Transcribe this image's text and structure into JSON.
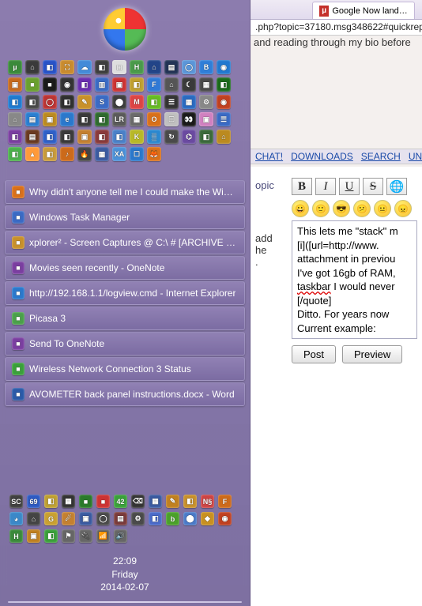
{
  "start": {
    "app_grid": [
      {
        "c": "#3a8a3a",
        "l": "µ"
      },
      {
        "c": "#3a3a3a",
        "l": "⌂"
      },
      {
        "c": "#2752c7",
        "l": "◧"
      },
      {
        "c": "#c98b2e",
        "l": "⛶"
      },
      {
        "c": "#438bd8",
        "l": "☁"
      },
      {
        "c": "#3d3d3d",
        "l": "◧"
      },
      {
        "c": "#dedede",
        "l": "◻"
      },
      {
        "c": "#4a9a4a",
        "l": "H"
      },
      {
        "c": "#224488",
        "l": "⌂"
      },
      {
        "c": "#223355",
        "l": "▤"
      },
      {
        "c": "#5a95d8",
        "l": "◯"
      },
      {
        "c": "#2f7ed8",
        "l": "B"
      },
      {
        "c": "#2178cf",
        "l": "◉"
      },
      {
        "c": "#c66a1e",
        "l": "▣"
      },
      {
        "c": "#6aa02e",
        "l": "■"
      },
      {
        "c": "#1a1a1a",
        "l": "■"
      },
      {
        "c": "#333",
        "l": "◉"
      },
      {
        "c": "#6a2eb0",
        "l": "◧"
      },
      {
        "c": "#3a6ac4",
        "l": "▥"
      },
      {
        "c": "#c33",
        "l": "▣"
      },
      {
        "c": "#c0a030",
        "l": "◧"
      },
      {
        "c": "#3079d6",
        "l": "F"
      },
      {
        "c": "#555",
        "l": "⌂"
      },
      {
        "c": "#3a3a3a",
        "l": "☾"
      },
      {
        "c": "#4a4a4a",
        "l": "▦"
      },
      {
        "c": "#1a6a1a",
        "l": "◧"
      },
      {
        "c": "#1e7ad0",
        "l": "◧"
      },
      {
        "c": "#4a4a4a",
        "l": "◧"
      },
      {
        "c": "#b33",
        "l": "◯"
      },
      {
        "c": "#2f2f2f",
        "l": "◧"
      },
      {
        "c": "#c8902a",
        "l": "✎"
      },
      {
        "c": "#3a6ac4",
        "l": "S"
      },
      {
        "c": "#3d3d3d",
        "l": "⬤"
      },
      {
        "c": "#d44",
        "l": "M"
      },
      {
        "c": "#6b2",
        "l": "◧"
      },
      {
        "c": "#333",
        "l": "☰"
      },
      {
        "c": "#2a6ac0",
        "l": "▦"
      },
      {
        "c": "#888",
        "l": "⚙"
      },
      {
        "c": "#c04020",
        "l": "◉"
      },
      {
        "c": "#888",
        "l": "⌂"
      },
      {
        "c": "#2a7ed0",
        "l": "▤"
      },
      {
        "c": "#bb8a20",
        "l": "▣"
      },
      {
        "c": "#2a78cc",
        "l": "e"
      },
      {
        "c": "#3a3a3a",
        "l": "◧"
      },
      {
        "c": "#2e6a2e",
        "l": "◧"
      },
      {
        "c": "#5a5a5a",
        "l": "LR"
      },
      {
        "c": "#6a6a6a",
        "l": "▦"
      },
      {
        "c": "#d9701a",
        "l": "O"
      },
      {
        "c": "#c0c0c0",
        "l": "☐"
      },
      {
        "c": "#1a1a1a",
        "l": "👀"
      },
      {
        "c": "#d080c0",
        "l": "▣"
      },
      {
        "c": "#3a6ac4",
        "l": "☰"
      },
      {
        "c": "#7a3ea0",
        "l": "◧"
      },
      {
        "c": "#6a3a20",
        "l": "▤"
      },
      {
        "c": "#2f60c8",
        "l": "◧"
      },
      {
        "c": "#3a3a3a",
        "l": "◧"
      },
      {
        "c": "#c48030",
        "l": "▣"
      },
      {
        "c": "#8a3a3a",
        "l": "◧"
      },
      {
        "c": "#4a80c8",
        "l": "◧"
      },
      {
        "c": "#b8b828",
        "l": "K"
      },
      {
        "c": "#2a88d0",
        "l": "▒"
      },
      {
        "c": "#4a4a4a",
        "l": "↻"
      },
      {
        "c": "#6a4aa0",
        "l": "⌬"
      },
      {
        "c": "#3a6a3a",
        "l": "◧"
      },
      {
        "c": "#bb8a20",
        "l": "⌂"
      },
      {
        "c": "#4ab04a",
        "l": "◧"
      },
      {
        "c": "#ff9a3a",
        "l": "▴"
      },
      {
        "c": "#c89a3a",
        "l": "◧"
      },
      {
        "c": "#cc6a1a",
        "l": "♪"
      },
      {
        "c": "#444",
        "l": "🔥"
      },
      {
        "c": "#3a5aa0",
        "l": "▦"
      },
      {
        "c": "#4a90d8",
        "l": "XA"
      },
      {
        "c": "#2a78cc",
        "l": "☐"
      },
      {
        "c": "#d9701a",
        "l": "🦊"
      }
    ],
    "windows": [
      {
        "icon": "#d9701a",
        "label": "Why didn't anyone tell me I could make the Windo..."
      },
      {
        "icon": "#3a6ac4",
        "label": "Windows Task Manager"
      },
      {
        "icon": "#c8902a",
        "label": "xplorer² - Screen Captures @ C:\\ # [ARCHIVE @ C:\\]"
      },
      {
        "icon": "#7a3ea0",
        "label": "Movies seen recently - OneNote"
      },
      {
        "icon": "#2a78cc",
        "label": "http://192.168.1.1/logview.cmd - Internet Explorer"
      },
      {
        "icon": "#4aa04a",
        "label": "Picasa 3"
      },
      {
        "icon": "#7a3ea0",
        "label": "Send To OneNote"
      },
      {
        "icon": "#3aa03a",
        "label": "Wireless Network Connection 3 Status"
      },
      {
        "icon": "#2a5aa8",
        "label": "AVOMETER back panel instructions.docx - Word"
      }
    ],
    "tray": [
      {
        "c": "#404040",
        "l": "SC"
      },
      {
        "c": "#2d5ac2",
        "l": "69"
      },
      {
        "c": "#bfa030",
        "l": "◧"
      },
      {
        "c": "#333",
        "l": "▦"
      },
      {
        "c": "#2a7a2a",
        "l": "■"
      },
      {
        "c": "#c33",
        "l": "■"
      },
      {
        "c": "#3aa03a",
        "l": "42"
      },
      {
        "c": "#333",
        "l": "⌫"
      },
      {
        "c": "#3a5aa0",
        "l": "▦"
      },
      {
        "c": "#c08020",
        "l": "✎"
      },
      {
        "c": "#c8902a",
        "l": "◧"
      },
      {
        "c": "#c44",
        "l": "N§"
      },
      {
        "c": "#cc6a1a",
        "l": "F"
      },
      {
        "c": "#3a88c8",
        "l": "◕"
      },
      {
        "c": "#444",
        "l": "⌂"
      },
      {
        "c": "#c9a030",
        "l": "G"
      },
      {
        "c": "#c48030",
        "l": "☄"
      },
      {
        "c": "#3a5aa0",
        "l": "▣"
      },
      {
        "c": "#4a4a4a",
        "l": "◯"
      },
      {
        "c": "#7a3a3a",
        "l": "▤"
      },
      {
        "c": "#4a4a4a",
        "l": "⚙"
      },
      {
        "c": "#4a6ac8",
        "l": "◧"
      },
      {
        "c": "#4aa02a",
        "l": "b"
      },
      {
        "c": "#4a7ac8",
        "l": "⬤"
      },
      {
        "c": "#c89020",
        "l": "◆"
      },
      {
        "c": "#c04020",
        "l": "◉"
      },
      {
        "c": "#3a8a3a",
        "l": "H"
      },
      {
        "c": "#c08020",
        "l": "▣"
      },
      {
        "c": "#3aa03a",
        "l": "◧"
      },
      {
        "c": "#666",
        "l": "⚑"
      },
      {
        "c": "#666",
        "l": "🔌"
      },
      {
        "c": "#666",
        "l": "📶"
      },
      {
        "c": "#666",
        "l": "🔊"
      }
    ],
    "clock": {
      "time": "22:09",
      "day": "Friday",
      "date": "2014-02-07"
    }
  },
  "browser": {
    "tab": "Google Now lands o...",
    "url": ".php?topic=37180.msg348622#quickreply",
    "body_fragment": "and reading through my bio before",
    "nav": [
      "CHAT!",
      "DOWNLOADS",
      "SEARCH",
      "UNRE"
    ],
    "topic_label": "opic",
    "side_text": "add\nhe\n.",
    "format_buttons": [
      "B",
      "I",
      "U",
      "S",
      "🌐"
    ],
    "emoticons": [
      "😀",
      "🙂",
      "😎",
      "😕",
      "😐",
      "😠"
    ],
    "editor_text": "This lets me \"stack\" m\n[i]([url=http://www.\nattachment in previou\nI've got 16gb of RAM,\ntaskbar I would never\n[/quote]\nDitto. For years now \nCurrent example:",
    "squiggly": "taskbar",
    "buttons": {
      "post": "Post",
      "preview": "Preview"
    }
  }
}
